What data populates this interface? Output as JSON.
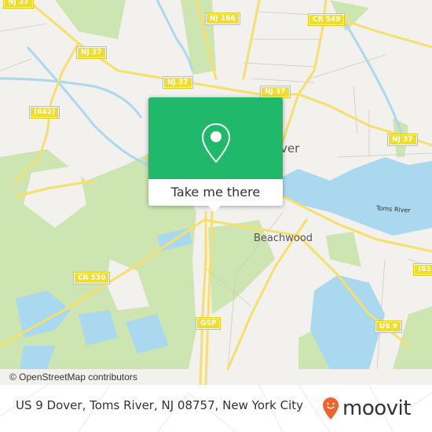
{
  "map": {
    "attribution": "© OpenStreetMap contributors",
    "road_shields": [
      {
        "id": "nj37-a",
        "label": "NJ 37"
      },
      {
        "id": "nj37-b",
        "label": "NJ 37"
      },
      {
        "id": "nj37-c",
        "label": "NJ 37"
      },
      {
        "id": "nj37-d",
        "label": "NJ 37"
      },
      {
        "id": "nj37-e",
        "label": "NJ 37"
      },
      {
        "id": "nj166",
        "label": "NJ 166"
      },
      {
        "id": "cr549",
        "label": "CR 549"
      },
      {
        "id": "r642",
        "label": "(642)"
      },
      {
        "id": "cr530",
        "label": "CR 530"
      },
      {
        "id": "gsp",
        "label": "GSP"
      },
      {
        "id": "us9",
        "label": "US 9"
      },
      {
        "id": "r61x",
        "label": "(61"
      }
    ],
    "places": {
      "dover": "ver",
      "beachwood": "Beachwood",
      "toms_river": "Toms River"
    },
    "colors": {
      "land": "#f2f1ed",
      "park": "#cde5b0",
      "water": "#a9d8ef",
      "road": "#f6df6a",
      "accent": "#1fb969"
    }
  },
  "popup": {
    "icon": "map-pin-icon",
    "button_label": "Take me there"
  },
  "footer": {
    "address": "US 9 Dover, Toms River, NJ 08757, New York City",
    "logo_icon": "moovit-face-pin-icon",
    "logo_text": "moovit",
    "logo_color": "#f0622e"
  }
}
